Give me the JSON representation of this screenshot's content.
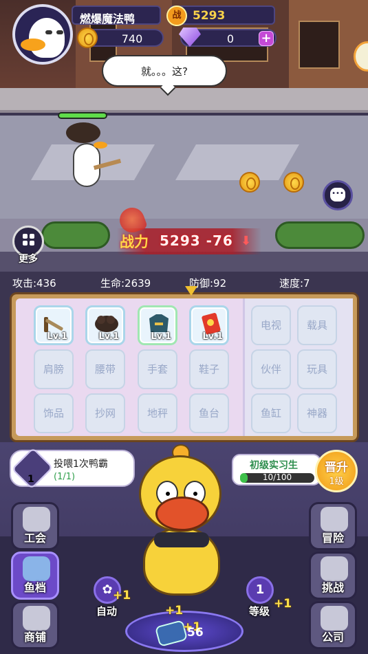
{
  "player": {
    "name": "燃爆魔法鸭",
    "power_icon": "战",
    "power": "5293",
    "gold": "740",
    "gems": "0",
    "gem_plus": "+"
  },
  "speech": "就。。。这?",
  "more_label": "更多",
  "power_banner": {
    "label": "战力",
    "value": "5293",
    "delta": "-76"
  },
  "player_hp_fraction": 1.0,
  "stats": [
    {
      "label": "攻击:436"
    },
    {
      "label": "生命:2639"
    },
    {
      "label": "防御:92"
    },
    {
      "label": "速度:7"
    }
  ],
  "equipment": {
    "equipped": [
      {
        "icon": "rifle-icon",
        "level": "Lv.1"
      },
      {
        "icon": "wig-icon",
        "level": "Lv.1"
      },
      {
        "icon": "jacket-icon",
        "level": "Lv.1"
      },
      {
        "icon": "snack-bag-icon",
        "level": "Lv.1"
      }
    ],
    "empty_left": [
      "肩膀",
      "腰带",
      "手套",
      "鞋子",
      "饰品",
      "抄网",
      "地秤",
      "鱼台"
    ],
    "empty_right": [
      "电视",
      "载具",
      "伙伴",
      "玩具",
      "鱼缸",
      "神器"
    ]
  },
  "quest": {
    "count": "1",
    "text": "投喂1次鸭霸",
    "progress": "(1/1)"
  },
  "rank": {
    "title": "初级实习生",
    "progress_text": "10/100",
    "progress_fraction": 0.1
  },
  "promote": {
    "title": "晋升",
    "sub": "1级"
  },
  "left_menu": [
    {
      "label": "工会",
      "icon": "guild-crown-icon"
    },
    {
      "label": "鱼档",
      "icon": "fish-stall-icon"
    },
    {
      "label": "商铺",
      "icon": "shop-clock-icon"
    }
  ],
  "right_menu": [
    {
      "label": "冒险",
      "icon": "dog-adventure-icon"
    },
    {
      "label": "挑战",
      "icon": "dog-challenge-icon"
    },
    {
      "label": "公司",
      "icon": "computer-company-icon"
    }
  ],
  "auto": {
    "label": "自动",
    "plus": "+1"
  },
  "level": {
    "label": "等级",
    "value": "1",
    "plus": "+1"
  },
  "feed": {
    "count": "56",
    "plus": "+1",
    "plus_left": "+1"
  },
  "colors": {
    "accent": "#6c4ac8",
    "gold": "#f8d24a",
    "green": "#3ec04a"
  }
}
